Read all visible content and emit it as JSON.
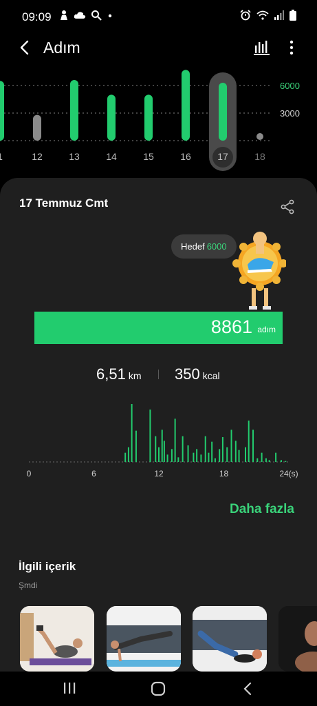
{
  "status_bar": {
    "time": "09:09",
    "left_icons": [
      "hands-icon",
      "cloud-icon",
      "search-icon",
      "dot-icon"
    ],
    "right_icons": [
      "alarm-icon",
      "wifi-icon",
      "signal-icon",
      "battery-icon"
    ]
  },
  "header": {
    "title": "Adım"
  },
  "day_chart": {
    "goal_label": "6000",
    "half_label": "3000",
    "days": [
      {
        "label": "1",
        "steps": 6500,
        "state": "above"
      },
      {
        "label": "12",
        "steps": 2800,
        "state": "below"
      },
      {
        "label": "13",
        "steps": 6600,
        "state": "above"
      },
      {
        "label": "14",
        "steps": 5000,
        "state": "above"
      },
      {
        "label": "15",
        "steps": 5000,
        "state": "above"
      },
      {
        "label": "16",
        "steps": 7700,
        "state": "above"
      },
      {
        "label": "17",
        "steps": 6300,
        "state": "selected"
      },
      {
        "label": "18",
        "steps": 0,
        "state": "future"
      }
    ],
    "colors": {
      "above": "#22cc6e",
      "below": "#8a8a8a",
      "future": "#8a8a8a",
      "selected_bg": "#4a4a4a",
      "selected_label": "#2e2e2e",
      "goal_label": "#3ad37a",
      "half_label": "#cfcfcf"
    }
  },
  "card": {
    "date": "17 Temmuz Cmt",
    "goal": {
      "label": "Hedef",
      "value": "6000"
    },
    "progress": {
      "value": "8861",
      "unit": "adım",
      "fraction": 1.0
    },
    "distance": {
      "value": "6,51",
      "unit": "km"
    },
    "calories": {
      "value": "350",
      "unit": "kcal"
    },
    "more_label": "Daha fazla"
  },
  "chart_data": {
    "type": "bar",
    "x_ticks": [
      "0",
      "6",
      "12",
      "18",
      "24(s)"
    ],
    "x_range": [
      0,
      24
    ],
    "values": [
      [
        8.9,
        10
      ],
      [
        9.2,
        16
      ],
      [
        9.5,
        63
      ],
      [
        9.9,
        34
      ],
      [
        11.2,
        57
      ],
      [
        11.7,
        28
      ],
      [
        12.0,
        16
      ],
      [
        12.3,
        35
      ],
      [
        12.5,
        23
      ],
      [
        12.8,
        8
      ],
      [
        13.2,
        14
      ],
      [
        13.5,
        47
      ],
      [
        13.8,
        5
      ],
      [
        14.2,
        28
      ],
      [
        14.7,
        18
      ],
      [
        15.2,
        10
      ],
      [
        15.5,
        14
      ],
      [
        15.9,
        8
      ],
      [
        16.3,
        28
      ],
      [
        16.6,
        10
      ],
      [
        16.9,
        22
      ],
      [
        17.2,
        4
      ],
      [
        17.6,
        14
      ],
      [
        17.9,
        27
      ],
      [
        18.3,
        16
      ],
      [
        18.7,
        35
      ],
      [
        19.1,
        23
      ],
      [
        19.4,
        13
      ],
      [
        20.0,
        16
      ],
      [
        20.3,
        45
      ],
      [
        20.7,
        35
      ],
      [
        21.1,
        4
      ],
      [
        21.5,
        10
      ],
      [
        21.9,
        4
      ],
      [
        22.2,
        2
      ],
      [
        22.8,
        10
      ],
      [
        23.3,
        2
      ],
      [
        23.7,
        1
      ]
    ],
    "color": "#22cc6e"
  },
  "related": {
    "title": "İlgili içerik",
    "subtitle": "Şmdi",
    "items": [
      {
        "name": "crunch-workout"
      },
      {
        "name": "plank-reach-workout"
      },
      {
        "name": "leg-raise-workout"
      },
      {
        "name": "trainer-workout"
      }
    ]
  },
  "navbar": {
    "buttons": [
      "recent-apps",
      "home",
      "back"
    ]
  }
}
